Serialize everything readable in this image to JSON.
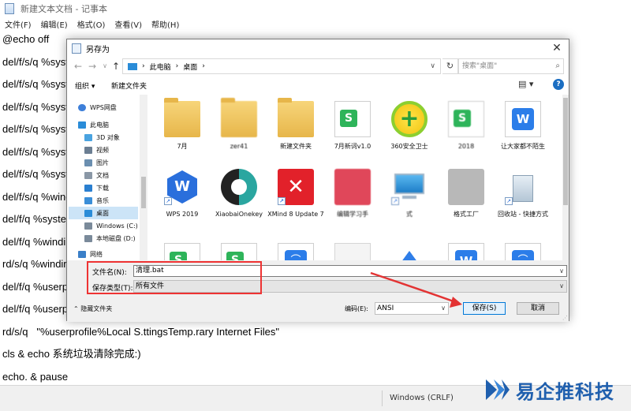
{
  "notepad": {
    "title": "新建文本文档 - 记事本",
    "menu": [
      "文件(F)",
      "编辑(E)",
      "格式(O)",
      "查看(V)",
      "帮助(H)"
    ],
    "lines": [
      "@echo off",
      "del/f/s/q %syste",
      "del/f/s/q %syste",
      "del/f/s/q %syste",
      "del/f/s/q %syste",
      "del/f/s/q %syste",
      "del/f/s/q %syste",
      "del/f/s/q %wind",
      "del/f/q %system",
      "del/f/q %windin",
      "rd/s/q %windir",
      "del/f/q %userpr",
      "del/f/q %userpr",
      "rd/s/q   \"%userprofile%Local S.ttingsTemp.rary Internet Files\"",
      "cls & echo 系统垃圾清除完成:)",
      "echo. & pause"
    ],
    "status_encoding": "Windows (CRLF)"
  },
  "watermark": {
    "text": "易企推科技"
  },
  "dialog": {
    "title": "另存为",
    "close": "✕",
    "breadcrumb": [
      "此电脑",
      "桌面"
    ],
    "search_placeholder": "搜索\"桌面\"",
    "toolbar": {
      "organize": "组织 ▾",
      "new_folder": "新建文件夹",
      "help": "?"
    },
    "nav_items": [
      {
        "label": "WPS网盘",
        "color": "#3d7fd9"
      },
      {
        "label": "此电脑",
        "color": "#2a8cd8"
      },
      {
        "label": "3D 对象",
        "color": "#4aa3e0"
      },
      {
        "label": "视频",
        "color": "#6b7e92"
      },
      {
        "label": "图片",
        "color": "#6b8fb0"
      },
      {
        "label": "文档",
        "color": "#8a97a6"
      },
      {
        "label": "下载",
        "color": "#2a7fd0"
      },
      {
        "label": "音乐",
        "color": "#3a8ed8"
      },
      {
        "label": "桌面",
        "color": "#2a8cd8"
      },
      {
        "label": "Windows (C:)",
        "color": "#7a8a9a"
      },
      {
        "label": "本地磁盘 (D:)",
        "color": "#7a8a9a"
      },
      {
        "label": "网络",
        "color": "#3a7fc8"
      }
    ],
    "files": [
      {
        "label": "7月",
        "icon": "folder"
      },
      {
        "label": "zer41",
        "icon": "folder"
      },
      {
        "label": "新建文件夹",
        "icon": "folder"
      },
      {
        "label": "7月新词v1.0",
        "icon": "sheet"
      },
      {
        "label": "360安全卫士",
        "icon": "360"
      },
      {
        "label": "2018",
        "icon": "sheet"
      },
      {
        "label": "让大家都不陌生",
        "icon": "wdoc"
      },
      {
        "label": "WPS 2019",
        "icon": "wps"
      },
      {
        "label": "XiaobaiOnekey",
        "icon": "xiao"
      },
      {
        "label": "XMind 8 Update 7",
        "icon": "xmind"
      },
      {
        "label": "编辑学习手",
        "icon": "xmind2"
      },
      {
        "label": "式",
        "icon": "pc"
      },
      {
        "label": "格式工厂",
        "icon": "tool"
      },
      {
        "label": "回收站 - 快捷方式",
        "icon": "bin"
      }
    ],
    "file_name_label": "文件名(N):",
    "file_name_value": "清理.bat",
    "file_type_label": "保存类型(T):",
    "file_type_value": "所有文件",
    "hide_folders": "隐藏文件夹",
    "encoding_label": "编码(E):",
    "encoding_value": "ANSI",
    "save_label": "保存(S)",
    "cancel_label": "取消"
  },
  "colors": {
    "accent": "#0078d7",
    "annotation": "#e33333"
  }
}
